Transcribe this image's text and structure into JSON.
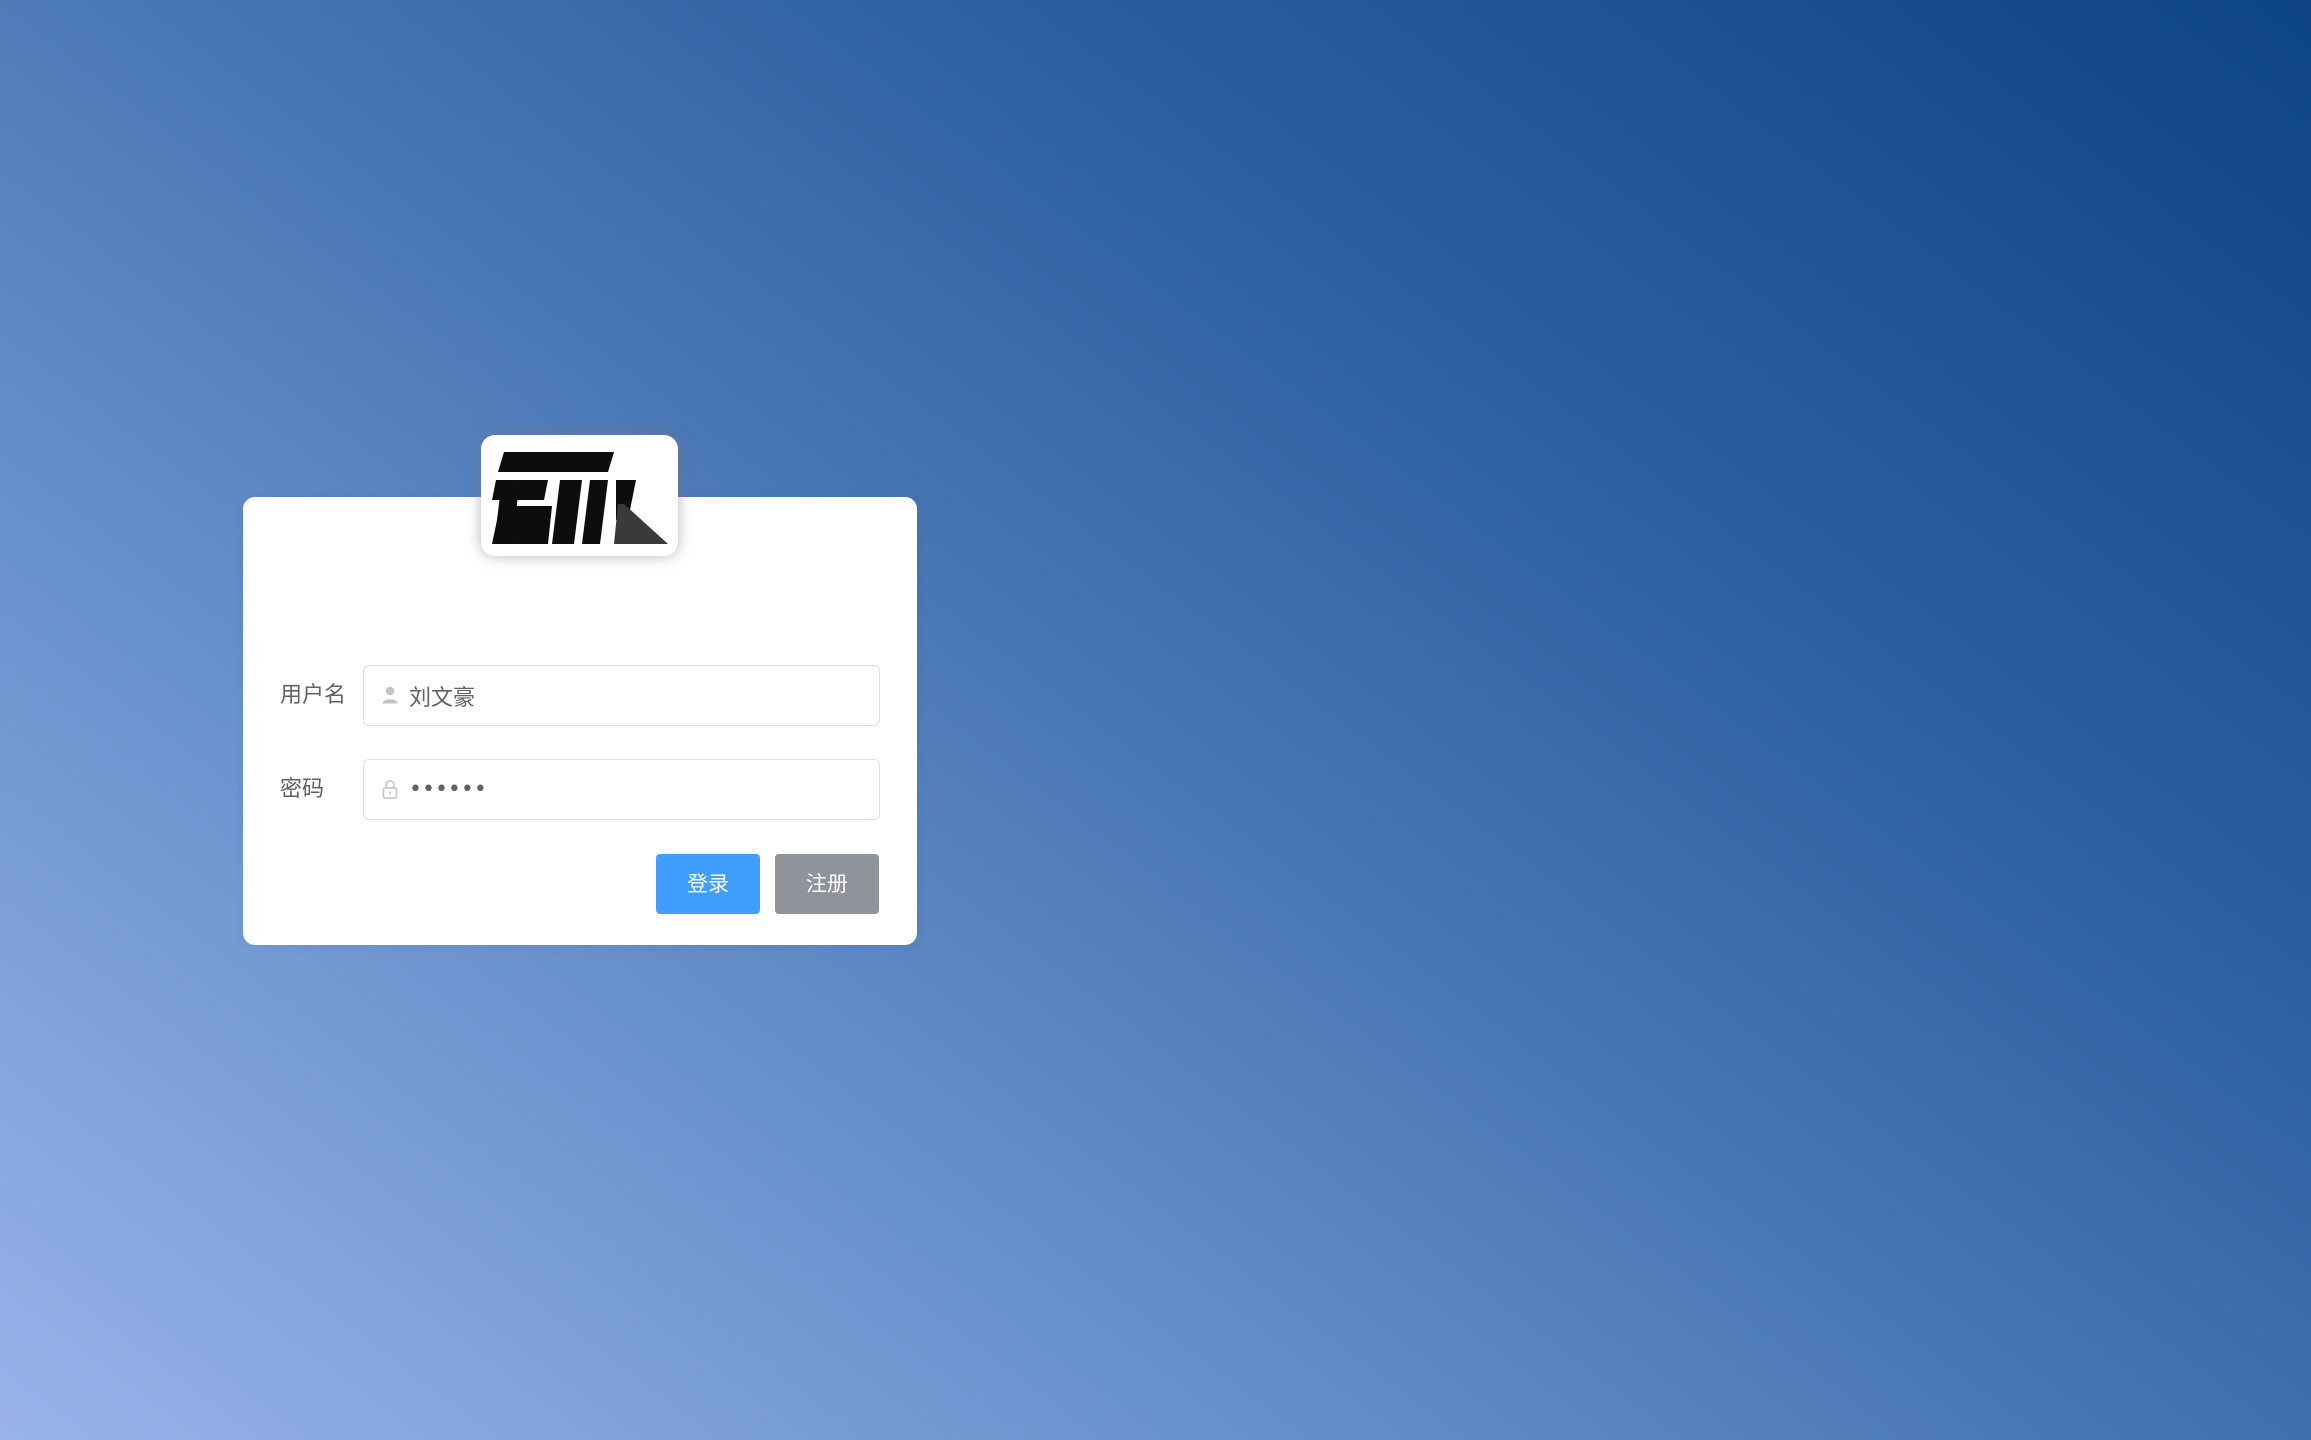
{
  "login": {
    "username_label": "用户名",
    "username_value": "刘文豪",
    "password_label": "密码",
    "password_value": "••••••",
    "login_button": "登录",
    "register_button": "注册"
  },
  "logo": {
    "text": "ETL"
  },
  "icons": {
    "username": "user-icon",
    "password": "lock-icon"
  },
  "colors": {
    "primary": "#409eff",
    "secondary": "#909399",
    "gradient_start": "#99b3ea",
    "gradient_end": "#0d4486"
  }
}
